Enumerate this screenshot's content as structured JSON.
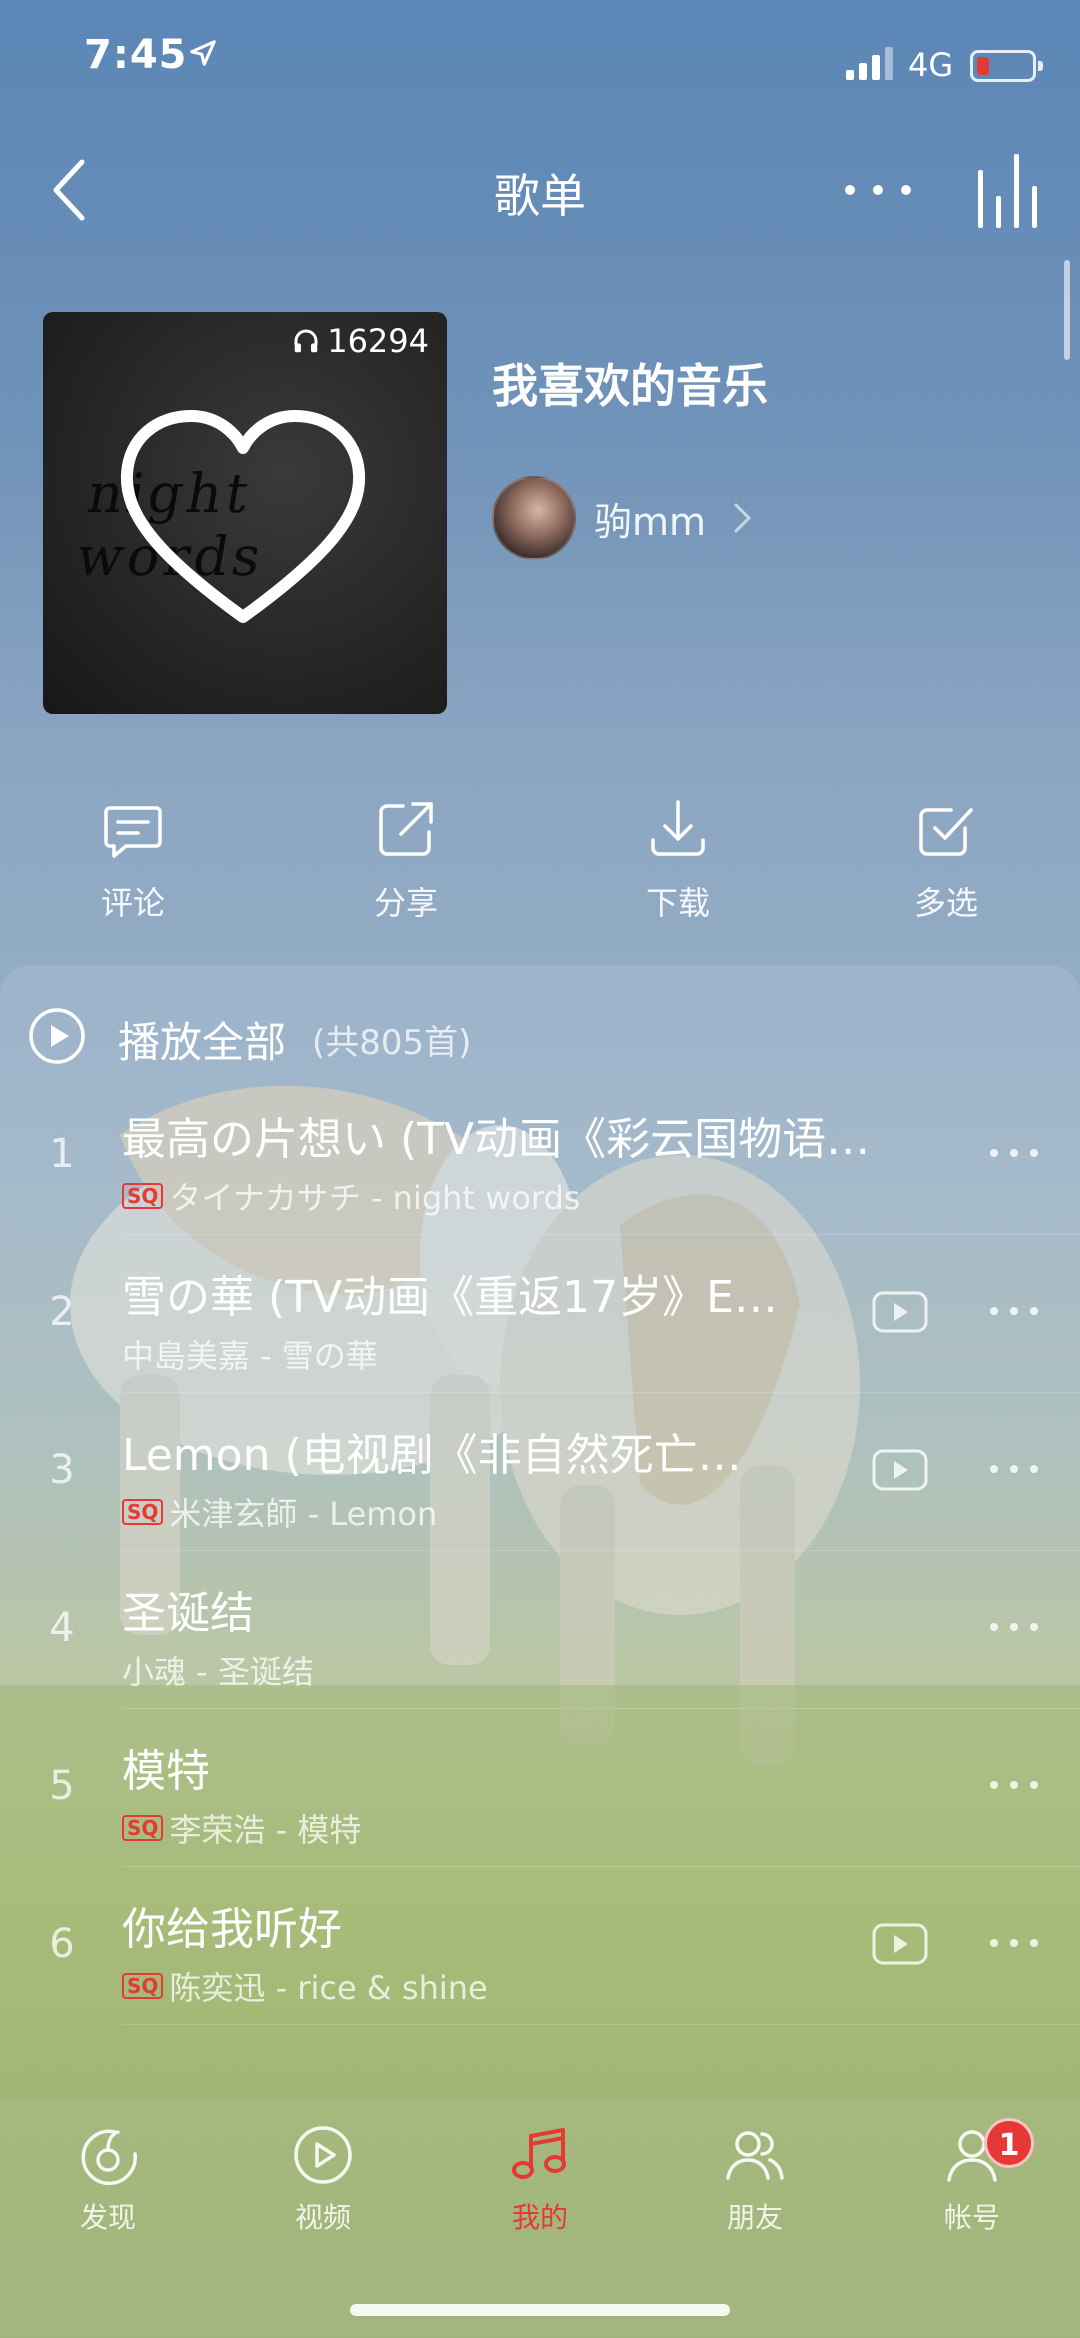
{
  "status": {
    "time": "7:45",
    "network": "4G"
  },
  "nav": {
    "title": "歌单"
  },
  "playlist": {
    "title": "我喜欢的音乐",
    "play_count": "16294",
    "cover_text": "night words",
    "creator": "驹mm"
  },
  "actions": [
    {
      "label": "评论",
      "icon": "comment-icon"
    },
    {
      "label": "分享",
      "icon": "share-icon"
    },
    {
      "label": "下载",
      "icon": "download-icon"
    },
    {
      "label": "多选",
      "icon": "multi-select-icon"
    }
  ],
  "play_all": {
    "label": "播放全部",
    "count": "(共805首)"
  },
  "songs": [
    {
      "num": "1",
      "title": "最高の片想い (TV动画《彩云国物语…",
      "sq": true,
      "artist": "タイナカサチ - night words",
      "mv": false
    },
    {
      "num": "2",
      "title": "雪の華 (TV动画《重返17岁》E…",
      "sq": false,
      "artist": "中島美嘉 - 雪の華",
      "mv": true
    },
    {
      "num": "3",
      "title": "Lemon (电视剧《非自然死亡…",
      "sq": true,
      "artist": "米津玄師 - Lemon",
      "mv": true
    },
    {
      "num": "4",
      "title": "圣诞结",
      "sq": false,
      "artist": "小魂 - 圣诞结",
      "mv": false
    },
    {
      "num": "5",
      "title": "模特",
      "sq": true,
      "artist": "李荣浩 - 模特",
      "mv": false
    },
    {
      "num": "6",
      "title": "你给我听好",
      "sq": true,
      "artist": "陈奕迅 - rice & shine",
      "mv": true
    }
  ],
  "sq_label": "SQ",
  "tabs": [
    {
      "label": "发现",
      "icon": "discover-icon"
    },
    {
      "label": "视频",
      "icon": "video-icon"
    },
    {
      "label": "我的",
      "icon": "music-note-icon",
      "active": true
    },
    {
      "label": "朋友",
      "icon": "friends-icon"
    },
    {
      "label": "帐号",
      "icon": "account-icon",
      "badge": "1"
    }
  ],
  "colors": {
    "accent": "#e53935"
  }
}
